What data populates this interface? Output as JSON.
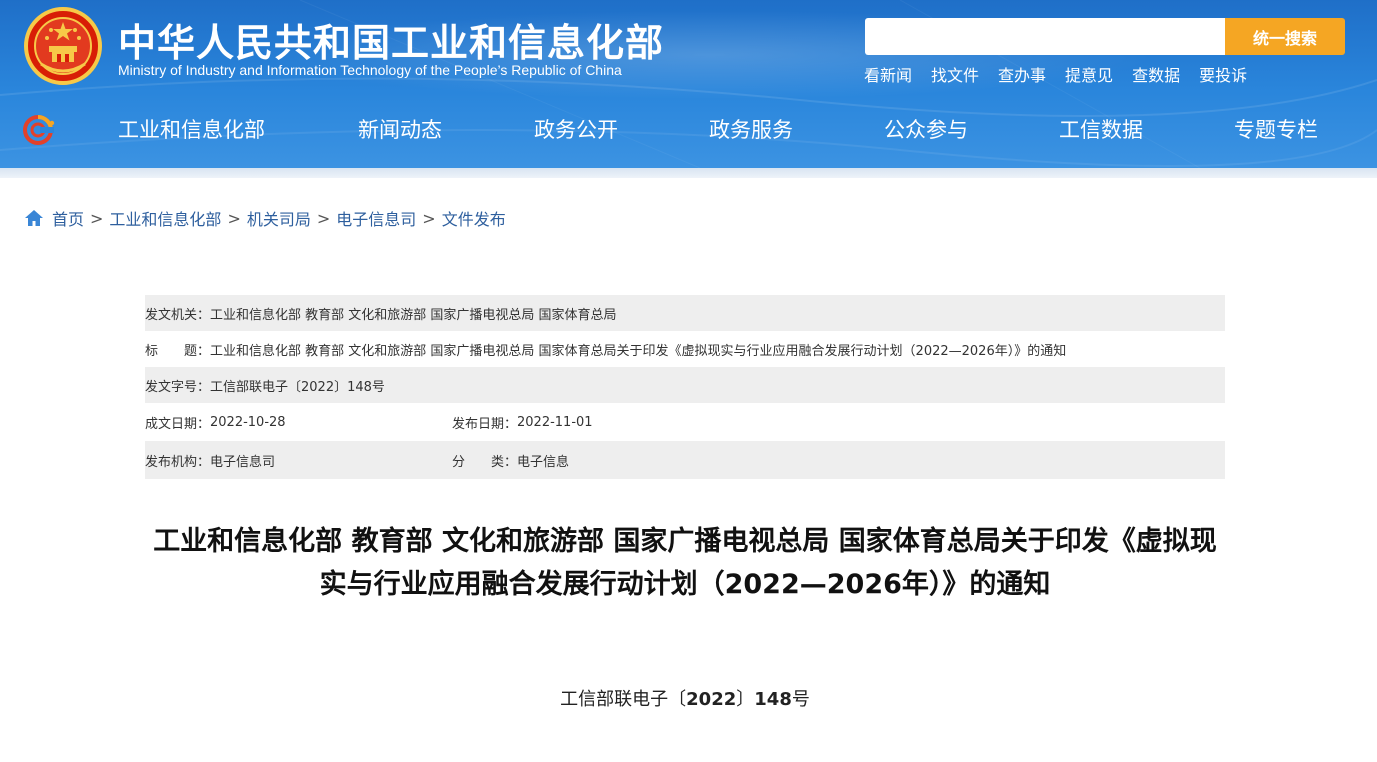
{
  "header": {
    "title": "中华人民共和国工业和信息化部",
    "subtitle": "Ministry of Industry and Information Technology of the People’s Republic of China",
    "search": {
      "placeholder": "",
      "button_label": "统一搜索"
    },
    "quick_links": [
      "看新闻",
      "找文件",
      "查办事",
      "提意见",
      "查数据",
      "要投诉"
    ],
    "colors": {
      "header_blue": "#2a86dc",
      "search_orange": "#f5a623"
    }
  },
  "nav": {
    "items": [
      "工业和信息化部",
      "新闻动态",
      "政务公开",
      "政务服务",
      "公众参与",
      "工信数据",
      "专题专栏"
    ]
  },
  "breadcrumb": {
    "icon": "home-icon",
    "items": [
      "首页",
      "工业和信息化部",
      "机关司局",
      "电子信息司",
      "文件发布"
    ],
    "separator": ">"
  },
  "info": {
    "issuer_label": "发文机关：",
    "issuer_value": "工业和信息化部 教育部 文化和旅游部 国家广播电视总局 国家体育总局",
    "title_label": "标　　题：",
    "title_value": "工业和信息化部 教育部 文化和旅游部 国家广播电视总局 国家体育总局关于印发《虚拟现实与行业应用融合发展行动计划（2022—2026年）》的通知",
    "doc_no_label": "发文字号：",
    "doc_no_value": "工信部联电子〔2022〕148号",
    "written_date_label": "成文日期：",
    "written_date_value": "2022-10-28",
    "publish_date_label": "发布日期：",
    "publish_date_value": "2022-11-01",
    "publisher_label": "发布机构：",
    "publisher_value": "电子信息司",
    "category_label": "分　　类：",
    "category_value": "电子信息"
  },
  "document": {
    "title": "工业和信息化部 教育部 文化和旅游部 国家广播电视总局 国家体育总局关于印发《虚拟现实与行业应用融合发展行动计划（2022—2026年）》的通知",
    "number_prefix": "工信部联电子〔",
    "number_year": "2022",
    "number_mid": "〕",
    "number_seq": "148",
    "number_suffix": "号"
  }
}
